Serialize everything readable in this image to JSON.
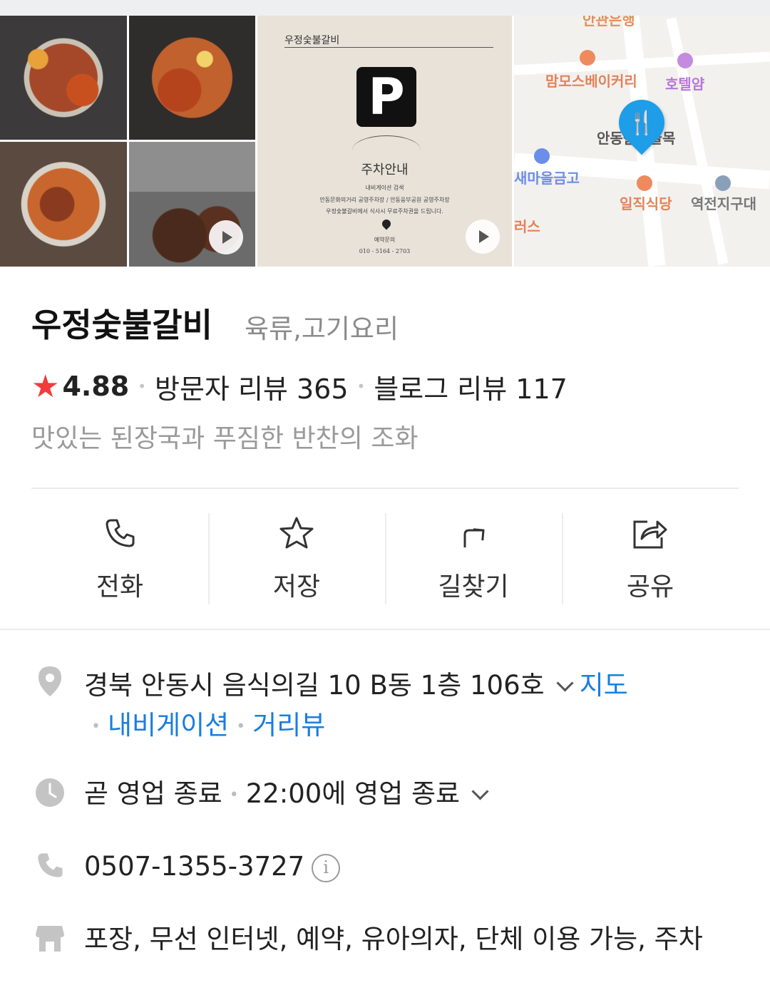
{
  "gallery": {
    "poster": {
      "brand": "우정숯불갈비",
      "p_letter": "P",
      "title": "주차안내",
      "line1": "내비게이션 검색",
      "line2": "안동문화의거리 공영주차장 / 안동웅부공원 공영주차장",
      "line3": "우정숯불갈비에서 식사시 무료주차권을 드립니다.",
      "contact_label": "예약문의",
      "contact_phone": "010 - 5164 - 2703"
    },
    "map_labels": {
      "top_cut": "안관은행",
      "bakery": "맘모스베이커리",
      "hotel": "호텔얌",
      "alley": "안동갈비골목",
      "bank": "새마을금고",
      "ilzik": "일직식당",
      "station": "역전지구대",
      "left_cut": "러스"
    }
  },
  "place": {
    "name": "우정숯불갈비",
    "category": "육류,고기요리",
    "rating": "4.88",
    "visitor_reviews": "방문자 리뷰 365",
    "blog_reviews": "블로그 리뷰 117",
    "tagline": "맛있는 된장국과 푸짐한 반찬의 조화"
  },
  "actions": {
    "call": "전화",
    "save": "저장",
    "directions": "길찾기",
    "share": "공유"
  },
  "info": {
    "address": "경북 안동시 음식의길 10 B동 1층 106호",
    "map_link": "지도",
    "navi_link": "내비게이션",
    "street_link": "거리뷰",
    "hours_status": "곧 영업 종료",
    "hours_detail": "22:00에 영업 종료",
    "phone": "0507-1355-3727",
    "amenities": "포장, 무선 인터넷, 예약, 유아의자, 단체 이용 가능, 주차"
  },
  "colors": {
    "link": "#1a7de0",
    "star": "#f23b3b",
    "pin": "#1e9de8"
  }
}
